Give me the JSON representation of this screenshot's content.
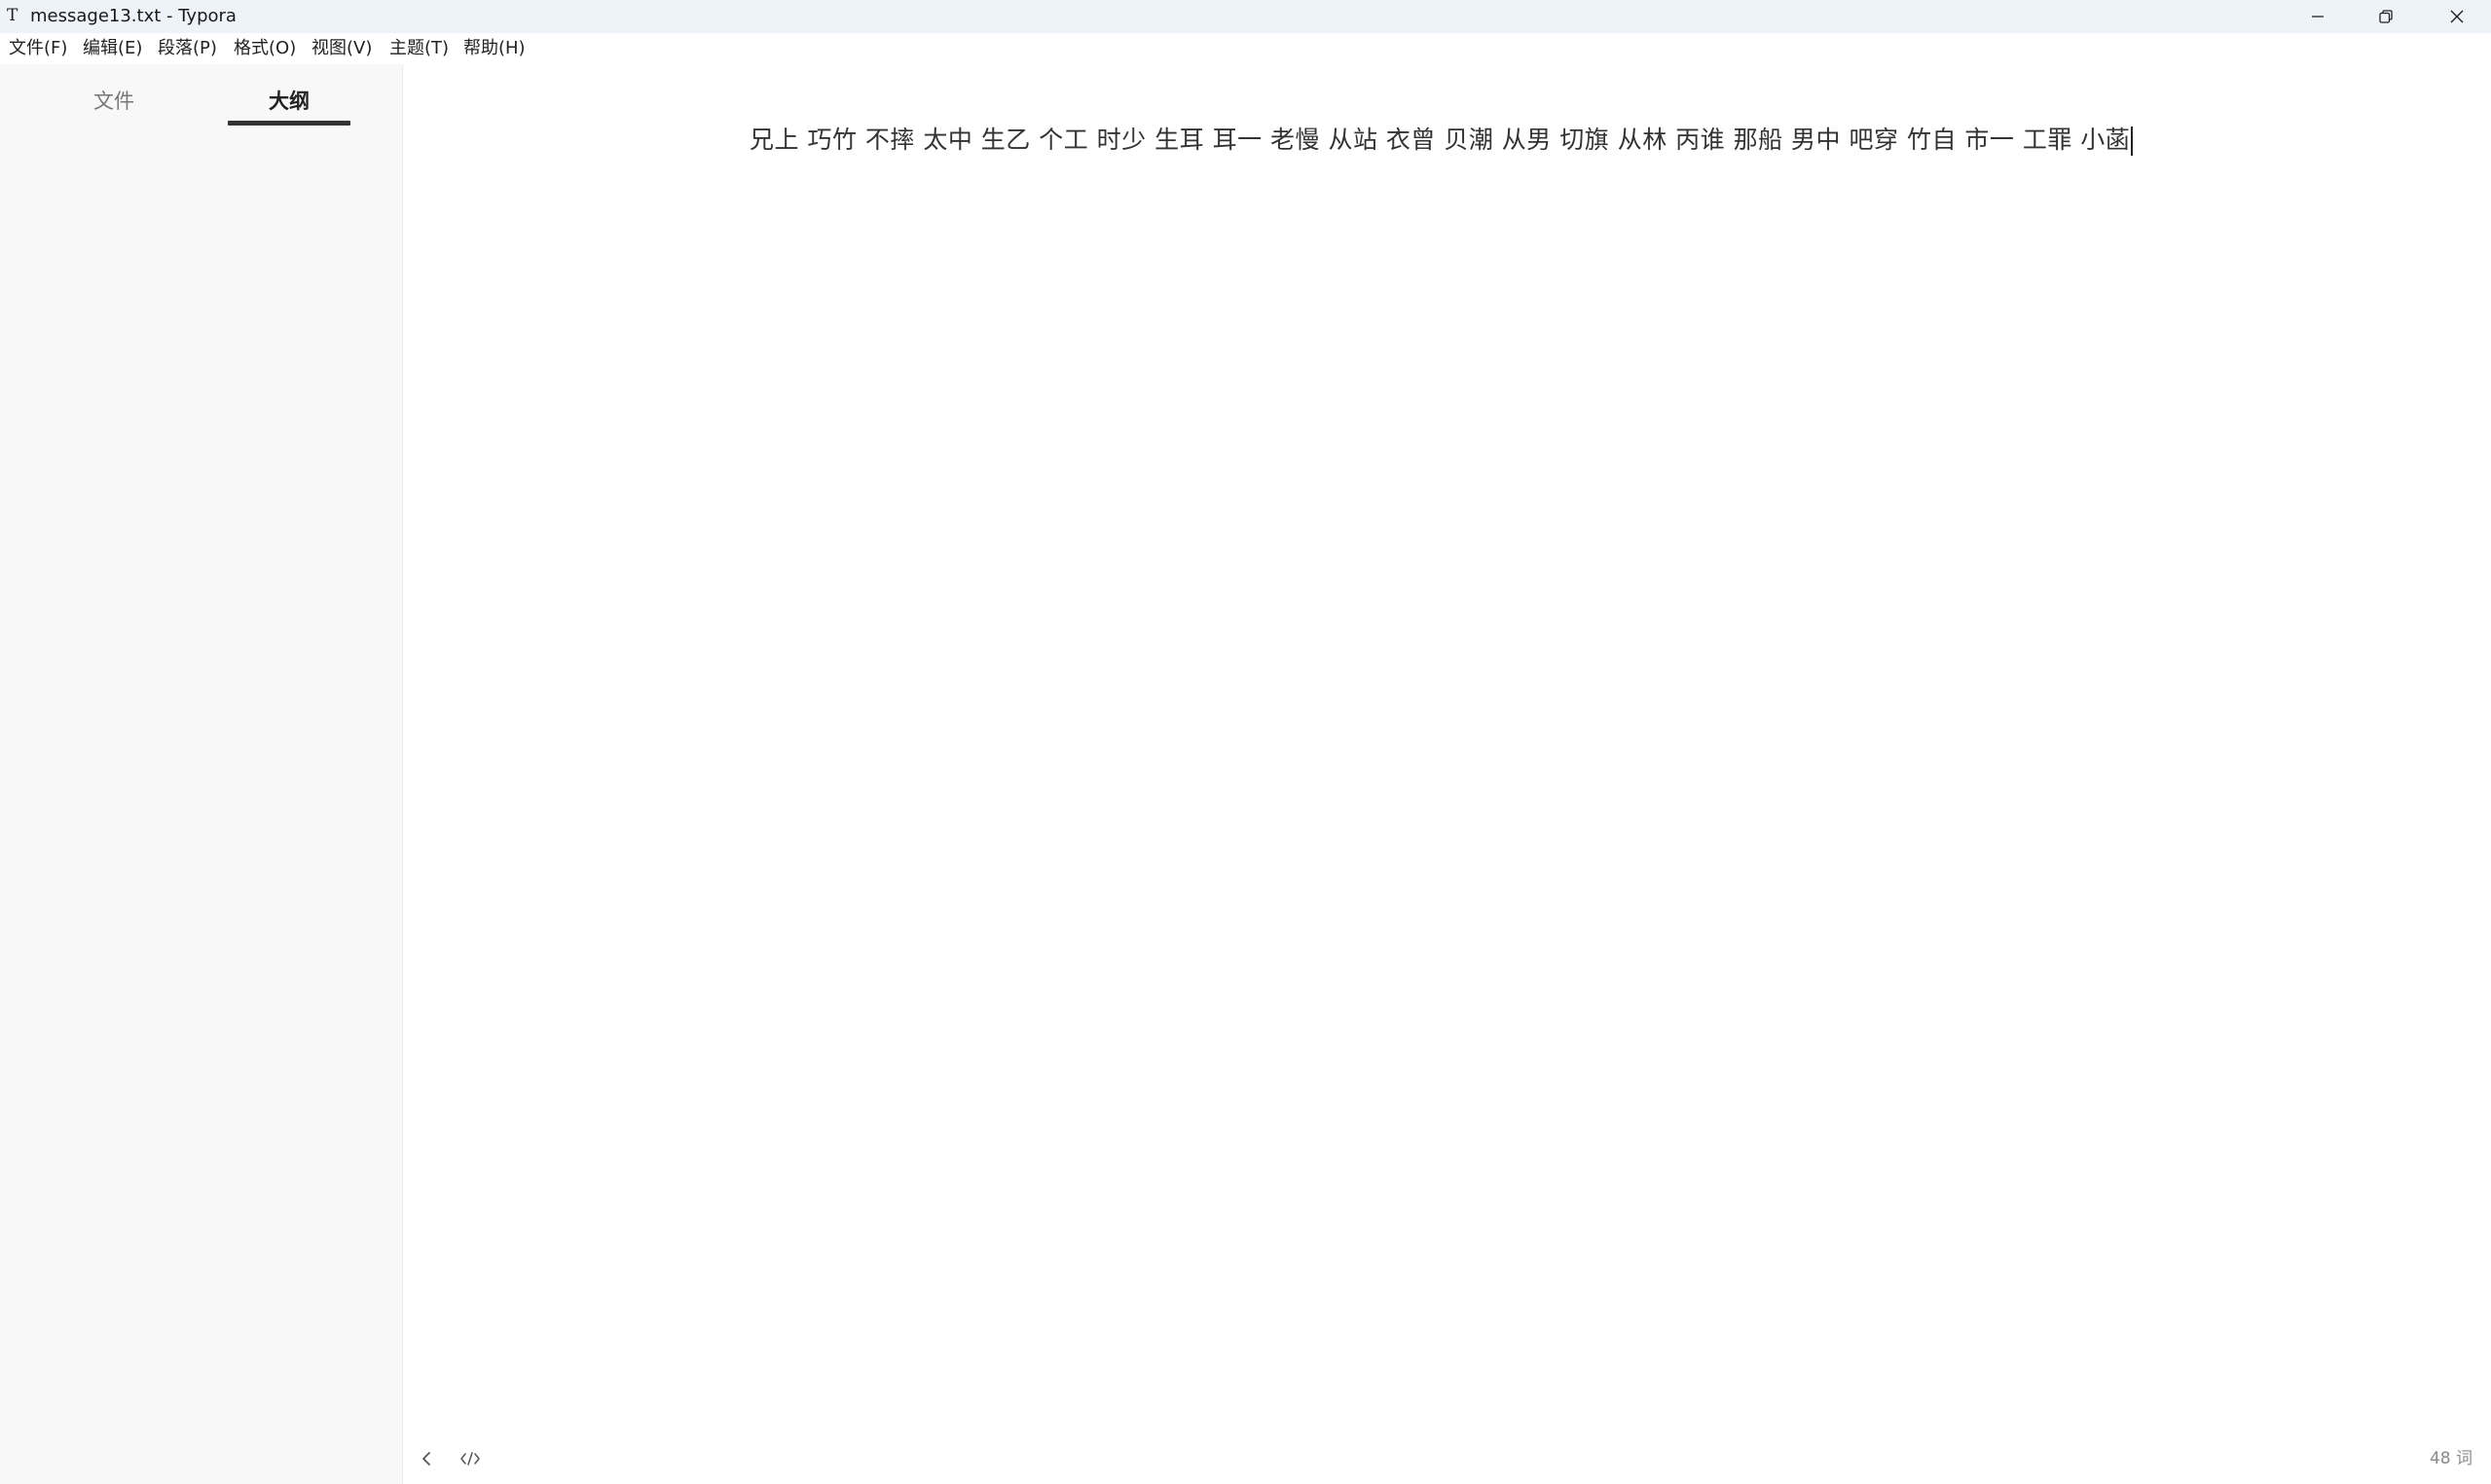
{
  "window": {
    "app_icon": "T",
    "title": "message13.txt - Typora",
    "controls": {
      "minimize_icon": "minimize-icon",
      "restore_icon": "restore-icon",
      "close_icon": "close-icon"
    }
  },
  "menu": {
    "items": [
      {
        "label": "文件(F)"
      },
      {
        "label": "编辑(E)"
      },
      {
        "label": "段落(P)"
      },
      {
        "label": "格式(O)"
      },
      {
        "label": "视图(V)"
      },
      {
        "label": "主题(T)"
      },
      {
        "label": "帮助(H)"
      }
    ]
  },
  "sidebar": {
    "tabs": [
      {
        "label": "文件",
        "active": false
      },
      {
        "label": "大纲",
        "active": true
      }
    ]
  },
  "editor": {
    "content": "兄上 巧竹 不摔 太中 生乙 个工 时少 生耳 耳一 老慢 从站 衣曾 贝潮 从男 切旗 从林 丙谁 那船 男中 吧穿 竹自 市一 工罪 小菡"
  },
  "footer": {
    "back_icon": "chevron-left-icon",
    "source_icon": "code-icon",
    "word_count": "48 词"
  },
  "colors": {
    "titlebar_bg": "#eef3fa",
    "sidebar_bg": "#f8f8f8",
    "text": "#333333"
  }
}
